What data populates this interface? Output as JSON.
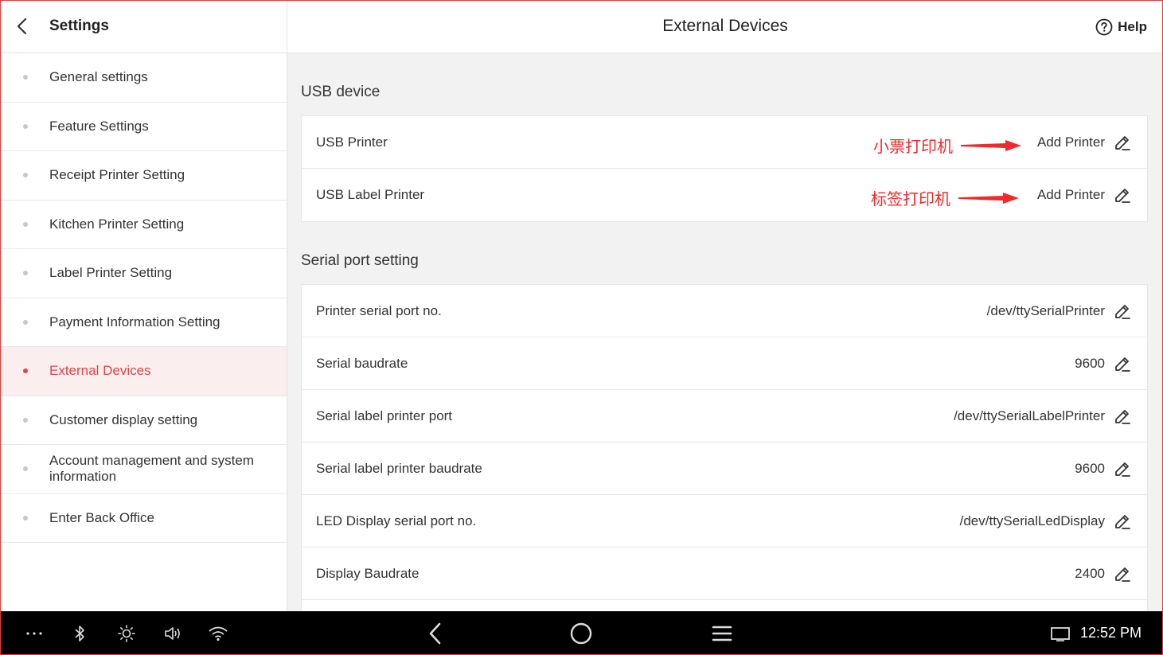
{
  "sidebar": {
    "title": "Settings",
    "items": [
      {
        "label": "General settings",
        "active": false
      },
      {
        "label": "Feature Settings",
        "active": false
      },
      {
        "label": "Receipt Printer Setting",
        "active": false
      },
      {
        "label": "Kitchen Printer Setting",
        "active": false
      },
      {
        "label": "Label Printer Setting",
        "active": false
      },
      {
        "label": "Payment Information Setting",
        "active": false
      },
      {
        "label": "External Devices",
        "active": true
      },
      {
        "label": "Customer display setting",
        "active": false
      },
      {
        "label": "Account management and system information",
        "active": false
      },
      {
        "label": "Enter Back Office",
        "active": false
      }
    ]
  },
  "header": {
    "title": "External Devices",
    "help_label": "Help"
  },
  "usb": {
    "section_title": "USB device",
    "rows": [
      {
        "label": "USB Printer",
        "value": "Add Printer",
        "annotation": "小票打印机"
      },
      {
        "label": "USB Label Printer",
        "value": "Add Printer",
        "annotation": "标签打印机"
      }
    ]
  },
  "serial": {
    "section_title": "Serial port setting",
    "rows": [
      {
        "label": "Printer serial port no.",
        "value": "/dev/ttySerialPrinter"
      },
      {
        "label": "Serial baudrate",
        "value": "9600"
      },
      {
        "label": "Serial label printer port",
        "value": "/dev/ttySerialLabelPrinter"
      },
      {
        "label": "Serial label printer baudrate",
        "value": "9600"
      },
      {
        "label": "LED Display serial port no.",
        "value": "/dev/ttySerialLedDisplay"
      },
      {
        "label": "Display Baudrate",
        "value": "2400"
      }
    ]
  },
  "navbar": {
    "time": "12:52 PM",
    "icons": [
      "more-icon",
      "bluetooth-icon",
      "brightness-icon",
      "volume-icon",
      "wifi-icon",
      "nav-back-icon",
      "nav-home-icon",
      "nav-menu-icon",
      "screen-icon"
    ]
  },
  "colors": {
    "accent": "#e04545",
    "annotation": "#ee2a2a",
    "active_bg": "#fbeeee",
    "main_bg": "#f2f2f2"
  }
}
